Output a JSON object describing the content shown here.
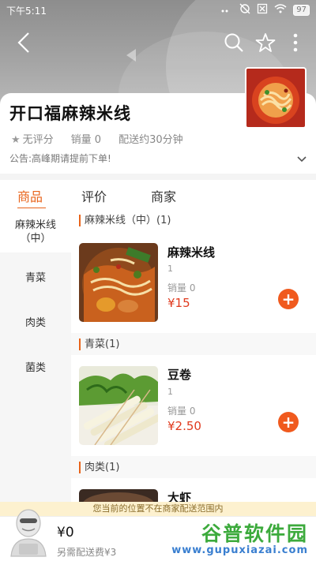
{
  "status_bar": {
    "time": "下午5:11",
    "battery": "97"
  },
  "shop": {
    "name": "开口福麻辣米线",
    "rating": "无评分",
    "sales": "销量 0",
    "delivery": "配送约30分钟",
    "notice": "公告:高峰期请提前下单!"
  },
  "tabs": [
    {
      "label": "商品",
      "active": true
    },
    {
      "label": "评价",
      "active": false
    },
    {
      "label": "商家",
      "active": false
    }
  ],
  "sidebar": {
    "items": [
      {
        "label": "麻辣米线（中）",
        "active": true
      },
      {
        "label": "青菜",
        "active": false
      },
      {
        "label": "肉类",
        "active": false
      },
      {
        "label": "菌类",
        "active": false
      }
    ]
  },
  "sections": [
    {
      "title": "麻辣米线（中）(1)",
      "dish": {
        "name": "麻辣米线",
        "count": "1",
        "sales": "销量 0",
        "price": "¥15"
      }
    },
    {
      "title": "青菜(1)",
      "dish": {
        "name": "豆卷",
        "count": "1",
        "sales": "销量 0",
        "price": "¥2.50"
      }
    },
    {
      "title": "肉类(1)",
      "dish": {
        "name": "大虾"
      }
    }
  ],
  "cart": {
    "range_notice": "您当前的位置不在商家配送范围内",
    "total": "¥0",
    "fee": "另需配送费¥3"
  },
  "watermark": {
    "title": "谷普软件园",
    "url": "www.gupuxiazai.com"
  },
  "colors": {
    "accent": "#e8631a",
    "price": "#e03a1e",
    "add_button": "#f05a1e"
  }
}
